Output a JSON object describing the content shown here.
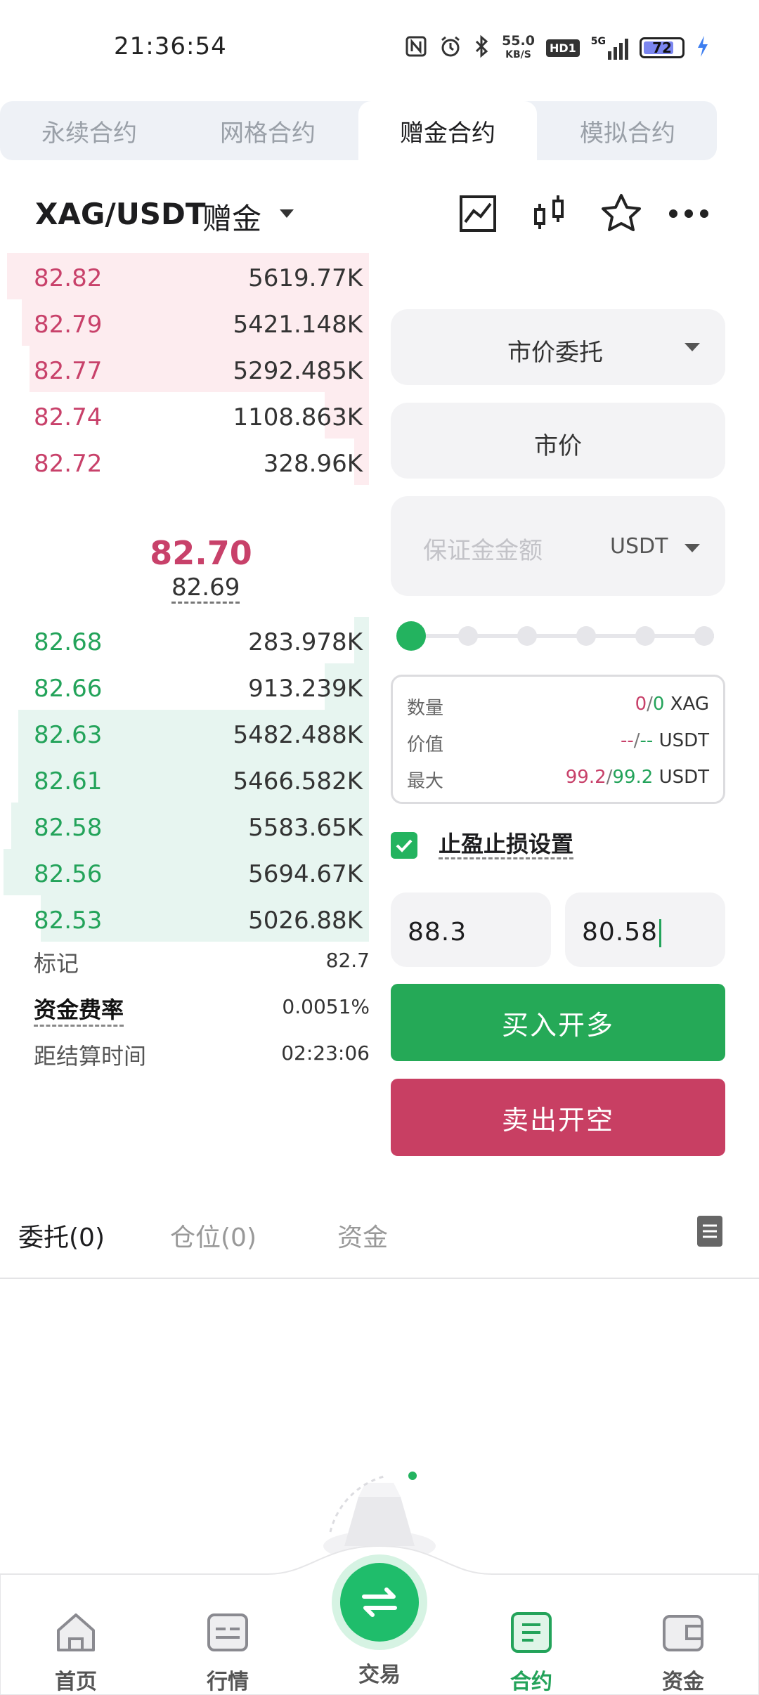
{
  "status_bar": {
    "time": "21:36:54",
    "net_speed_value": "55.0",
    "net_speed_unit": "KB/S",
    "hd_badge": "HD1",
    "signal_label": "5G",
    "battery_level": "72"
  },
  "contract_tabs": [
    "永续合约",
    "网格合约",
    "赠金合约",
    "模拟合约"
  ],
  "active_contract_tab": 2,
  "header": {
    "pair": "XAG/USDT",
    "bonus_label": "赠金",
    "icons": [
      "chart-line-icon",
      "candlestick-icon",
      "star-icon",
      "more-icon"
    ]
  },
  "orderbook": {
    "asks": [
      {
        "price": "82.82",
        "qty": "5619.77K",
        "depth": 0.98
      },
      {
        "price": "82.79",
        "qty": "5421.148K",
        "depth": 0.94
      },
      {
        "price": "82.77",
        "qty": "5292.485K",
        "depth": 0.92
      },
      {
        "price": "82.74",
        "qty": "1108.863K",
        "depth": 0.12
      },
      {
        "price": "82.72",
        "qty": "328.96K",
        "depth": 0.04
      }
    ],
    "last_price": "82.70",
    "mark_price": "82.69",
    "bids": [
      {
        "price": "82.68",
        "qty": "283.978K",
        "depth": 0.04
      },
      {
        "price": "82.66",
        "qty": "913.239K",
        "depth": 0.12
      },
      {
        "price": "82.63",
        "qty": "5482.488K",
        "depth": 0.95
      },
      {
        "price": "82.61",
        "qty": "5466.582K",
        "depth": 0.95
      },
      {
        "price": "82.58",
        "qty": "5583.65K",
        "depth": 0.97
      },
      {
        "price": "82.56",
        "qty": "5694.67K",
        "depth": 0.99
      },
      {
        "price": "82.53",
        "qty": "5026.88K",
        "depth": 0.89
      }
    ]
  },
  "market_info": {
    "mark_label": "标记",
    "mark_value": "82.7",
    "funding_label": "资金费率",
    "funding_value": "0.0051%",
    "settle_label": "距结算时间",
    "settle_value": "02:23:06"
  },
  "trade_panel": {
    "order_type": "市价委托",
    "price_field": "市价",
    "margin_placeholder": "保证金金额",
    "margin_unit": "USDT",
    "slider_percent": 0,
    "qty_label": "数量",
    "qty_sell": "0",
    "qty_buy": "0",
    "qty_unit": "XAG",
    "value_label": "价值",
    "value_sell": "--",
    "value_buy": "--",
    "value_unit": "USDT",
    "max_label": "最大",
    "max_buy": "99.2",
    "max_sell": "99.2",
    "max_unit": "USDT",
    "tpsl_label": "止盈止损设置",
    "tpsl_checked": true,
    "take_profit": "88.3",
    "stop_loss": "80.58",
    "buy_button": "买入开多",
    "sell_button": "卖出开空"
  },
  "order_tabs": [
    "委托(0)",
    "仓位(0)",
    "资金"
  ],
  "bottom_nav": [
    {
      "label": "首页",
      "icon": "home-icon"
    },
    {
      "label": "行情",
      "icon": "market-icon"
    },
    {
      "label": "交易",
      "icon": "swap-icon"
    },
    {
      "label": "合约",
      "icon": "contract-icon"
    },
    {
      "label": "资金",
      "icon": "wallet-icon"
    }
  ],
  "active_nav": 3,
  "colors": {
    "green": "#23a35a",
    "pink": "#c8416a",
    "buy": "#25a957",
    "sell": "#c83f63"
  }
}
